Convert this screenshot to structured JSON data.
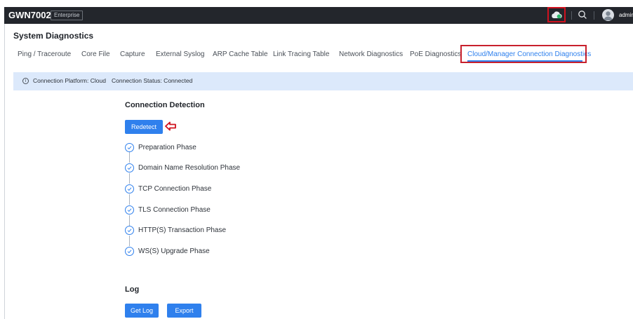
{
  "header": {
    "brand": "GWN7002",
    "edition": "Enterprise",
    "user": "admin",
    "icons": {
      "cloud": "cloud-icon",
      "search": "search-icon",
      "avatar": "user-avatar-icon"
    },
    "colors": {
      "bar": "#23262c",
      "cloud_status": "#2fb86c",
      "highlight": "#d0121f"
    }
  },
  "page_title": "System Diagnostics",
  "tabs": [
    {
      "label": "Ping / Traceroute"
    },
    {
      "label": "Core File"
    },
    {
      "label": "Capture"
    },
    {
      "label": "External Syslog"
    },
    {
      "label": "ARP Cache Table"
    },
    {
      "label": "Link Tracing Table"
    },
    {
      "label": "Network Diagnostics"
    },
    {
      "label": "PoE Diagnostics"
    },
    {
      "label": "Cloud/Manager Connection Diagnostics",
      "active": true
    }
  ],
  "info_bar": {
    "platform": "Connection Platform: Cloud",
    "status": "Connection Status: Connected"
  },
  "connection_detection": {
    "title": "Connection Detection",
    "redetect_label": "Redetect",
    "steps": [
      {
        "label": "Preparation Phase"
      },
      {
        "label": "Domain Name Resolution Phase"
      },
      {
        "label": "TCP Connection Phase"
      },
      {
        "label": "TLS Connection Phase"
      },
      {
        "label": "HTTP(S) Transaction Phase"
      },
      {
        "label": "WS(S) Upgrade Phase"
      }
    ]
  },
  "log": {
    "title": "Log",
    "get_log_label": "Get Log",
    "export_label": "Export"
  },
  "accent_color": "#2f80ed"
}
